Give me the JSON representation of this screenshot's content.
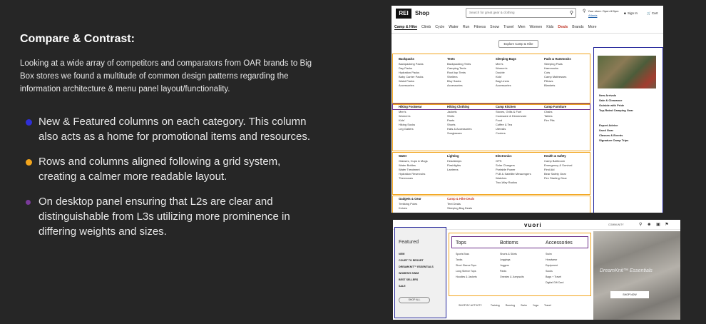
{
  "slide": {
    "title": "Compare & Contrast:",
    "intro": "Looking at a wide array of competitors and comparators from OAR brands to Big Box stores we found a multitude of common design patterns regarding the information architecture & menu panel layout/functionality.",
    "bullets": [
      {
        "text": "New & Featured columns on each category. This column also acts as a home for promotional items and resources.",
        "color": "#2f2fd6"
      },
      {
        "text": "Rows and columns aligned following a grid system, creating a calmer more readable layout.",
        "color": "#f2a51d"
      },
      {
        "text": "On desktop panel ensuring that L2s are clear and distinguishable from L3s utilizing more prominence in differing weights and sizes.",
        "color": "#7a3a9a"
      }
    ]
  },
  "rei": {
    "logo": "REI",
    "shop": "Shop",
    "search_placeholder": "Search for great gear & clothing",
    "store_line1": "Your store: Open til 9pm",
    "store_line2": "Atlanta",
    "signin": "Sign In",
    "cart": "Cart",
    "nav": [
      "Camp & Hike",
      "Climb",
      "Cycle",
      "Water",
      "Run",
      "Fitness",
      "Snow",
      "Travel",
      "Men",
      "Women",
      "Kids",
      "Deals",
      "Brands",
      "More"
    ],
    "explore": "Explore Camp & Hike",
    "columns": [
      {
        "head": "Backpacks",
        "items": [
          "Backpacking Packs",
          "Day Packs",
          "Hydration Packs",
          "Baby Carrier Packs",
          "Waist Packs",
          "Accessories"
        ]
      },
      {
        "head": "Tents",
        "items": [
          "Backpacking Tents",
          "Camping Tents",
          "Roof-top Tents",
          "Shelters",
          "Bivy Sacks",
          "Accessories"
        ]
      },
      {
        "head": "Sleeping Bags",
        "items": [
          "Men's",
          "Women's",
          "Double",
          "Kids'",
          "Bag Liners",
          "Accessories"
        ]
      },
      {
        "head": "Pads & Hammocks",
        "items": [
          "Sleeping Pads",
          "Hammocks",
          "Cots",
          "Camp Mattresses",
          "Pillows",
          "Blankets"
        ]
      },
      {
        "head": "Hiking Footwear",
        "items": [
          "Men's",
          "Women's",
          "Kids'",
          "Hiking Socks",
          "Leg Gaiters"
        ]
      },
      {
        "head": "Hiking Clothing",
        "items": [
          "Jackets",
          "Shirts",
          "Pants",
          "Shorts",
          "Hats & Accessories",
          "Sunglasses"
        ]
      },
      {
        "head": "Camp Kitchen",
        "items": [
          "Stoves, Grills & Fuel",
          "Cookware & Dinnerware",
          "Food",
          "Coffee & Tea",
          "Utensils",
          "Coolers"
        ]
      },
      {
        "head": "Camp Furniture",
        "items": [
          "Chairs",
          "Tables",
          "Fire Pits"
        ]
      },
      {
        "head": "Water",
        "items": [
          "Glasses, Cups & Mugs",
          "Water Bottles",
          "Water Treatment",
          "Hydration Reservoirs",
          "Thermoses"
        ]
      },
      {
        "head": "Lighting",
        "items": [
          "Headlamps",
          "Flashlights",
          "Lanterns"
        ]
      },
      {
        "head": "Electronics",
        "items": [
          "GPS",
          "Solar Chargers",
          "Portable Power",
          "PLB & Satellite Messengers",
          "Watches",
          "Two-Way Radios"
        ]
      },
      {
        "head": "Health & Safety",
        "items": [
          "Camp Bathroom",
          "Emergency & Survival",
          "First Aid",
          "Bear Safety Gear",
          "Fire Starting Gear"
        ]
      },
      {
        "head": "Gadgets & Gear",
        "items": [
          "Trekking Poles",
          "Knives"
        ]
      },
      {
        "head": "Camp & Hike Deals",
        "items": [
          "Tent Deals",
          "Sleeping Bag Deals"
        ]
      }
    ],
    "featured": [
      "New Arrivals",
      "Sale & Clearance",
      "Outside with Pride",
      "Top-Rated Camping Gear"
    ],
    "featured2": [
      "Expert Advice",
      "Used Gear",
      "Classes & Events",
      "Signature Camp Trips"
    ]
  },
  "vuori": {
    "logo": "vuori",
    "community": "COMMUNITY",
    "featured_title": "Featured",
    "featured_items": [
      "NEW",
      "COURT TO RESORT",
      "DREAMKNIT™ ESSENTIALS",
      "WOMEN'S SWIM",
      "BEST SELLERS",
      "SALE"
    ],
    "shop_all": "SHOP ALL",
    "categories": [
      {
        "head": "Tops",
        "items": [
          "Sports Bras",
          "Tanks",
          "Short Sleeve Tops",
          "Long Sleeve Tops",
          "Hoodies & Jackets"
        ]
      },
      {
        "head": "Bottoms",
        "items": [
          "Shorts & Skirts",
          "Leggings",
          "Joggers",
          "Pants",
          "Onesies & Jumpsuits"
        ]
      },
      {
        "head": "Accessories",
        "items": [
          "Swim",
          "Headwear",
          "Equipment",
          "Socks",
          "Bags + Travel",
          "Digital Gift Card"
        ]
      }
    ],
    "activity_label": "SHOP BY ACTIVITY",
    "activities": [
      "Training",
      "Running",
      "Swim",
      "Yoga",
      "Travel"
    ],
    "promo_text": "DreamKnit™ Essentials",
    "shop_now": "SHOP NOW"
  }
}
